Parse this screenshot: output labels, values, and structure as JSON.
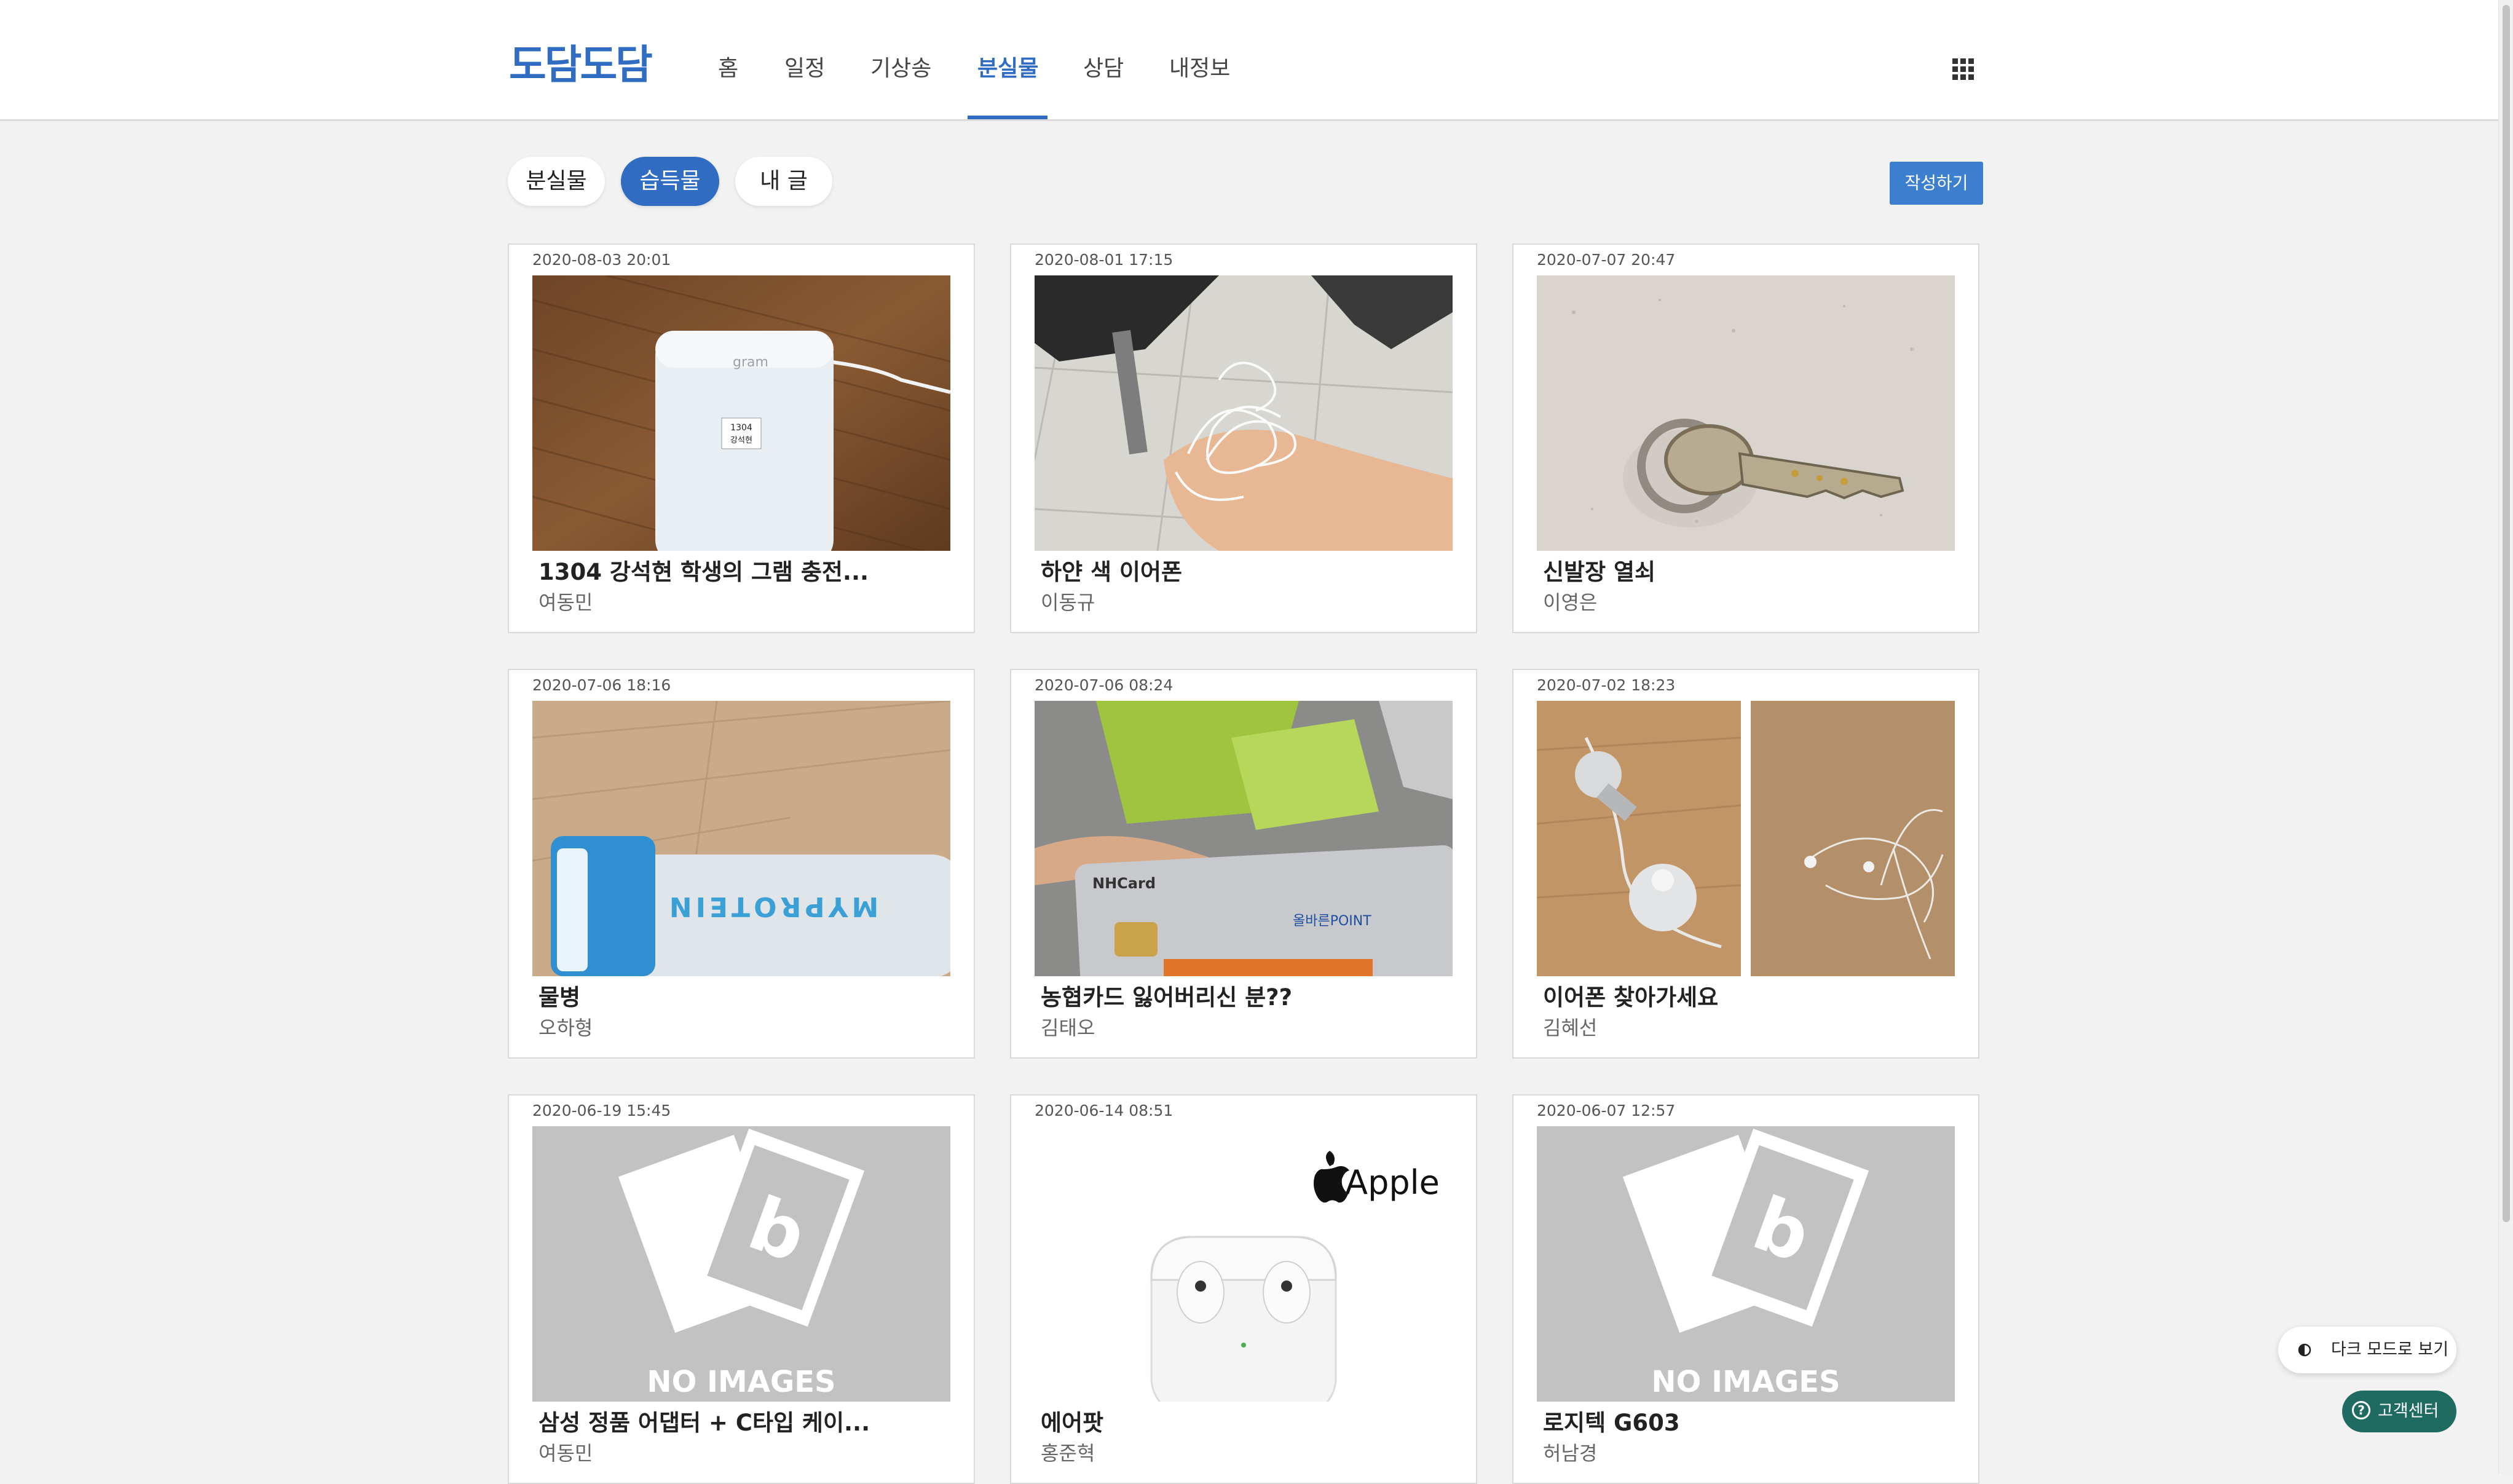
{
  "header": {
    "logo": "도담도담",
    "nav": [
      {
        "label": "홈"
      },
      {
        "label": "일정"
      },
      {
        "label": "기상송"
      },
      {
        "label": "분실물",
        "active": true
      },
      {
        "label": "상담"
      },
      {
        "label": "내정보"
      }
    ],
    "apps_icon": "grid-icon"
  },
  "filters": {
    "items": [
      {
        "label": "분실물"
      },
      {
        "label": "습득물",
        "active": true
      },
      {
        "label": "내 글"
      }
    ],
    "write_button": "작성하기"
  },
  "colors": {
    "accent": "#2f6cc2",
    "write_button": "#3d7fcf",
    "help_button": "#1f6b62",
    "background": "#f2f2f2"
  },
  "cards": [
    {
      "date": "2020-08-03 20:01",
      "title": "1304 강석현 학생의 그램 충전...",
      "author": "여동민",
      "image": "charger-photo",
      "image_text": [
        "gram",
        "1304",
        "강석현"
      ]
    },
    {
      "date": "2020-08-01 17:15",
      "title": "하얀 색 이어폰",
      "author": "이동규",
      "image": "earphones-in-hand-photo"
    },
    {
      "date": "2020-07-07 20:47",
      "title": "신발장 열쇠",
      "author": "이영은",
      "image": "key-photo"
    },
    {
      "date": "2020-07-06 18:16",
      "title": "물병",
      "author": "오하형",
      "image": "water-bottle-photo",
      "image_text": [
        "MYPROTEIN"
      ]
    },
    {
      "date": "2020-07-06 08:24",
      "title": "농협카드 잃어버리신 분??",
      "author": "김태오",
      "image": "nh-card-photo",
      "image_text": [
        "NHCard",
        "올바른POINT"
      ]
    },
    {
      "date": "2020-07-02 18:23",
      "title": "이어폰 찾아가세요",
      "author": "김혜선",
      "image": "earphones-two-photos"
    },
    {
      "date": "2020-06-19 15:45",
      "title": "삼성 정품 어댑터 + C타입 케이...",
      "author": "여동민",
      "image": "no-images-placeholder",
      "image_text": [
        "NO IMAGES"
      ]
    },
    {
      "date": "2020-06-14 08:51",
      "title": "에어팟",
      "author": "홍준혁",
      "image": "airpods-photo",
      "image_text": [
        "Apple"
      ]
    },
    {
      "date": "2020-06-07 12:57",
      "title": "로지텍 G603",
      "author": "허남경",
      "image": "no-images-placeholder",
      "image_text": [
        "NO IMAGES"
      ]
    }
  ],
  "floating": {
    "dark_mode": "다크 모드로 보기",
    "help": "고객센터"
  }
}
